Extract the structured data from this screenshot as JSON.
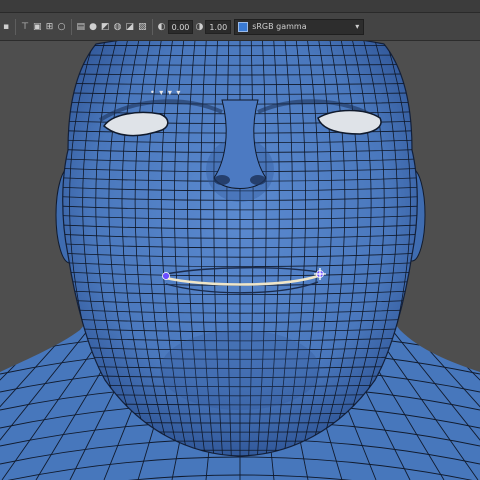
{
  "toolbar": {
    "icons": [
      "camera-icon",
      "bookmark-icon",
      "image-plane-icon",
      "film-gate-icon",
      "grid-icon",
      "wireframe-icon",
      "smooth-shade-icon",
      "textured-icon",
      "lights-icon",
      "shadows-icon",
      "xray-icon",
      "exposure-icon",
      "gamma-icon"
    ],
    "exposure_value": "0.00",
    "gamma_value": "1.00",
    "color_space_label": "sRGB gamma"
  },
  "viewport": {
    "hud_text": "• ▾ ▾ ▾",
    "colors": {
      "mesh_fill": "#4f7ec4",
      "mesh_dark": "#2a4a86",
      "wire": "#101a2c",
      "background": "#4e4e4e",
      "eye_socket": "#d9dde2",
      "lip_line": "#e8e0c8"
    },
    "selected_vertex_markers": [
      "left-lip-corner",
      "right-lip-corner"
    ]
  }
}
